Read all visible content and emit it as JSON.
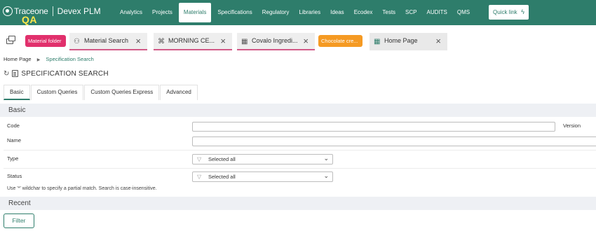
{
  "header": {
    "brand": "Traceone",
    "product": "Devex PLM",
    "env_badge": "QA",
    "nav": [
      {
        "label": "Analytics"
      },
      {
        "label": "Projects"
      },
      {
        "label": "Materials"
      },
      {
        "label": "Specifications"
      },
      {
        "label": "Regulatory"
      },
      {
        "label": "Libraries"
      },
      {
        "label": "Ideas"
      },
      {
        "label": "Ecodex"
      },
      {
        "label": "Tests"
      },
      {
        "label": "SCP"
      },
      {
        "label": "AUDITS"
      },
      {
        "label": "QMS"
      }
    ],
    "active_nav": "Materials",
    "quick_link": "Quick link",
    "colors": {
      "brand": "#2e7d6b",
      "env_badge": "#ffe84a"
    }
  },
  "tabs": {
    "items": [
      {
        "kind": "pill",
        "label": "Material folder",
        "color": "#e1306c"
      },
      {
        "kind": "tab",
        "label": "Material Search",
        "icon": "hierarchy-icon"
      },
      {
        "kind": "tab",
        "label": "MORNING CE...",
        "icon": "workflow-icon"
      },
      {
        "kind": "tab",
        "label": "Covalo Ingredi...",
        "icon": "table-icon"
      },
      {
        "kind": "pill",
        "label": "Chocolate cre...",
        "color": "#f59a23"
      },
      {
        "kind": "tab",
        "label": "Home Page",
        "icon": "grid-icon"
      }
    ]
  },
  "breadcrumb": {
    "home": "Home Page",
    "current": "Specification Search"
  },
  "page": {
    "title": "SPECIFICATION SEARCH"
  },
  "subtabs": [
    {
      "label": "Basic"
    },
    {
      "label": "Custom Queries"
    },
    {
      "label": "Custom Queries Express"
    },
    {
      "label": "Advanced"
    }
  ],
  "form": {
    "section_title": "Basic",
    "fields": {
      "code": {
        "label": "Code",
        "value": ""
      },
      "version": {
        "label": "Version"
      },
      "name": {
        "label": "Name",
        "value": ""
      },
      "type": {
        "label": "Type",
        "value": "Selected all"
      },
      "status": {
        "label": "Status",
        "value": "Selected all"
      }
    },
    "hint": "Use '*' wildchar to specify a partial match. Search is case-insensitive."
  },
  "recent": {
    "section_title": "Recent"
  },
  "actions": {
    "filter": "Filter"
  }
}
